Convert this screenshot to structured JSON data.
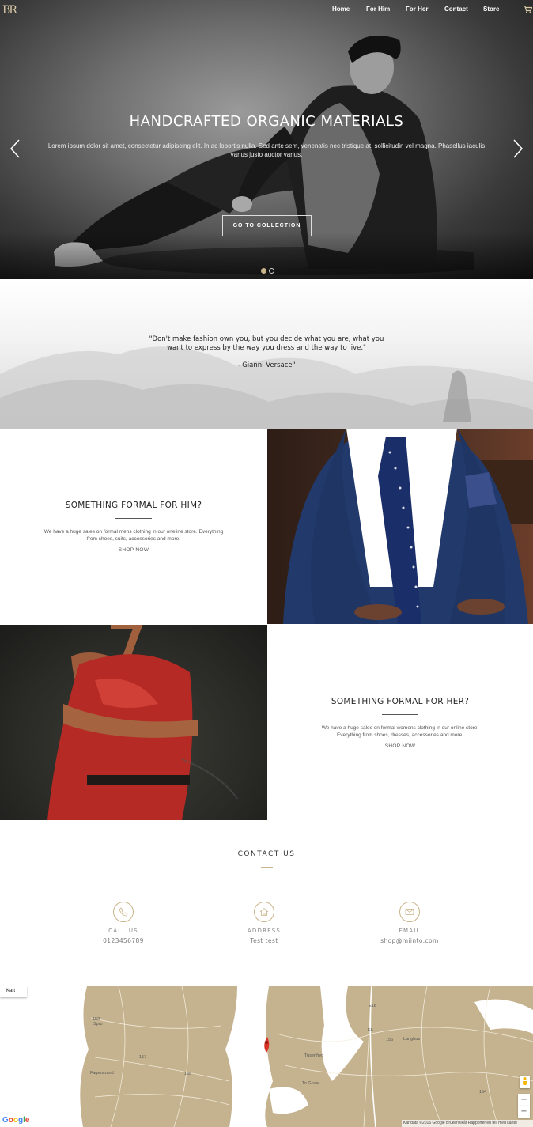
{
  "nav": {
    "logo": "BR",
    "items": [
      "Home",
      "For Him",
      "For Her",
      "Contact",
      "Store"
    ],
    "cart_icon": "cart-icon"
  },
  "hero": {
    "title": "HANDCRAFTED ORGANIC MATERIALS",
    "subtitle": "Lorem ipsum dolor sit amet, consectetur adipiscing elit. In ac lobortis nulla. Sed ante sem, venenatis nec tristique at, sollicitudin vel magna. Phasellus iaculis varius justo auctor varius.",
    "button": "GO TO COLLECTION",
    "slide_count": 2,
    "active_slide": 1
  },
  "quote": {
    "text": "\"Don't make fashion own you, but you decide what you are, what you want to express by the way you dress and the way to live.\"",
    "author": "- Gianni Versace\""
  },
  "him": {
    "title": "SOMETHING FORMAL FOR HIM?",
    "body": "We have a huge sales on formal mens clothing in our oneline store. Everything from shoes, suits, accessories and more.",
    "link": "SHOP NOW"
  },
  "her": {
    "title": "SOMETHING FORMAL FOR HER?",
    "body": "We have a huge sales on formal womens clothing in our online store. Everything from shoes, dresses, accessories and more.",
    "link": "SHOP NOW"
  },
  "contact": {
    "title": "CONTACT US",
    "items": [
      {
        "label": "CALL US",
        "value": "0123456789",
        "icon": "phone-icon"
      },
      {
        "label": "ADDRESS",
        "value": "Test test",
        "icon": "home-icon"
      },
      {
        "label": "EMAIL",
        "value": "shop@miinto.com",
        "icon": "mail-icon"
      }
    ]
  },
  "map": {
    "tab": "Kart",
    "places": [
      "Fagerstrand",
      "Tusenfryd",
      "To Gruve",
      "Langhus",
      "Spro"
    ],
    "roads": [
      "152",
      "157",
      "155",
      "156",
      "154",
      "E6",
      "E18"
    ],
    "zoom_in": "+",
    "zoom_out": "−",
    "footer": "Kartdata ©2016 Google   Brukervilkår   Rapporter en feil med kartet",
    "google": "Google",
    "colors": {
      "land": "#c5b38f",
      "water": "#ffffff",
      "marker": "#d93025"
    }
  }
}
